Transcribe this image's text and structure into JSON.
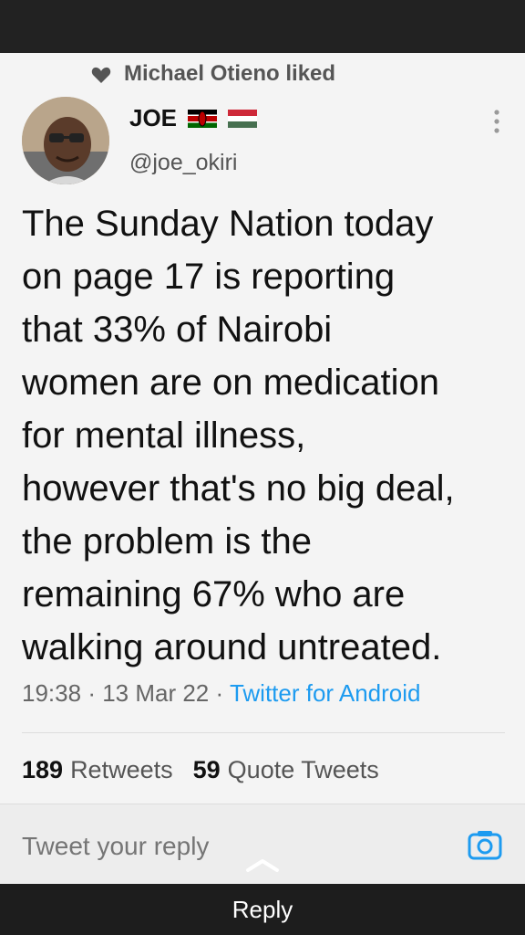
{
  "liked_by": "Michael Otieno liked",
  "user": {
    "display_name": "JOE",
    "handle": "@joe_okiri"
  },
  "tweet": {
    "text": "The Sunday Nation today\non page 17 is reporting\nthat 33% of Nairobi\nwomen are on medication\nfor mental illness,\nhowever that's no big deal,\nthe problem is the\nremaining 67% who are\nwalking around untreated.",
    "time": "19:38",
    "date": "13 Mar 22",
    "source": "Twitter for Android"
  },
  "stats": {
    "retweets_count": "189",
    "retweets_label": "Retweets",
    "quote_count": "59",
    "quote_label": "Quote Tweets"
  },
  "reply": {
    "placeholder": "Tweet your reply",
    "bottom_label": "Reply"
  },
  "icons": {
    "heart": "heart-icon",
    "more": "more-vertical-icon",
    "camera": "camera-icon",
    "chevron": "chevron-up-icon"
  },
  "colors": {
    "accent": "#1d9bf0",
    "text": "#111111",
    "muted": "#666666"
  }
}
